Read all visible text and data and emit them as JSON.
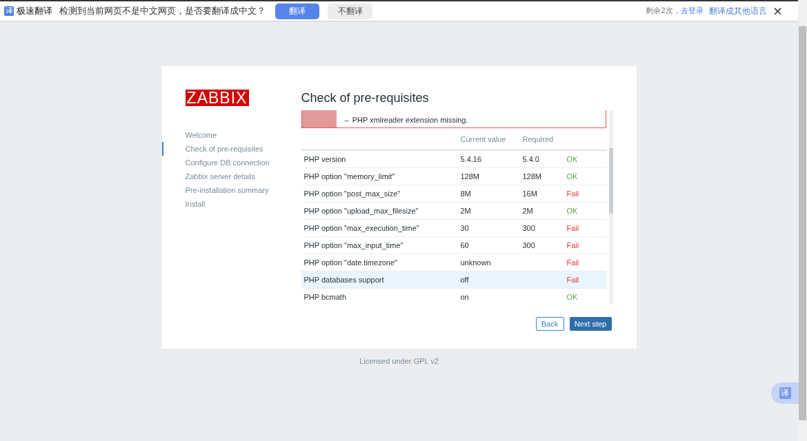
{
  "translate_bar": {
    "icon": "译",
    "app_name": "极速翻译",
    "message": "检测到当前网页不是中文网页，是否要翻译成中文？",
    "translate_button": "翻译",
    "dismiss_button": "不翻译",
    "remaining": "剩余2次，",
    "login_link": "去登录",
    "other_language_link": "翻译成其他语言",
    "close": "×"
  },
  "logo": "ZABBIX",
  "nav": [
    {
      "label": "Welcome",
      "selected": false
    },
    {
      "label": "Check of pre-requisites",
      "selected": true
    },
    {
      "label": "Configure DB connection",
      "selected": false
    },
    {
      "label": "Zabbix server details",
      "selected": false
    },
    {
      "label": "Pre-installation summary",
      "selected": false
    },
    {
      "label": "Install",
      "selected": false
    }
  ],
  "title": "Check of pre-requisites",
  "error_message": {
    "bullet": "–",
    "items": [
      "PHP xmlreader extension missing."
    ]
  },
  "table": {
    "columns": [
      "Current value",
      "Required"
    ],
    "rows": [
      {
        "name": "PHP version",
        "current": "5.4.16",
        "required": "5.4.0",
        "result": "OK",
        "passed": true,
        "selected": false
      },
      {
        "name": "PHP option \"memory_limit\"",
        "current": "128M",
        "required": "128M",
        "result": "OK",
        "passed": true,
        "selected": false
      },
      {
        "name": "PHP option \"post_max_size\"",
        "current": "8M",
        "required": "16M",
        "result": "Fail",
        "passed": false,
        "selected": false
      },
      {
        "name": "PHP option \"upload_max_filesize\"",
        "current": "2M",
        "required": "2M",
        "result": "OK",
        "passed": true,
        "selected": false
      },
      {
        "name": "PHP option \"max_execution_time\"",
        "current": "30",
        "required": "300",
        "result": "Fail",
        "passed": false,
        "selected": false
      },
      {
        "name": "PHP option \"max_input_time\"",
        "current": "60",
        "required": "300",
        "result": "Fail",
        "passed": false,
        "selected": false
      },
      {
        "name": "PHP option \"date.timezone\"",
        "current": "unknown",
        "result": "Fail",
        "passed": false,
        "selected": false
      },
      {
        "name": "PHP databases support",
        "current": "off",
        "result": "Fail",
        "passed": false,
        "selected": true
      },
      {
        "name": "PHP bcmath",
        "current": "on",
        "result": "OK",
        "passed": true,
        "selected": false
      }
    ]
  },
  "buttons": {
    "back": "Back",
    "next": "Next step"
  },
  "footer": "Licensed under GPL v2",
  "float_translate_icon": "译"
}
